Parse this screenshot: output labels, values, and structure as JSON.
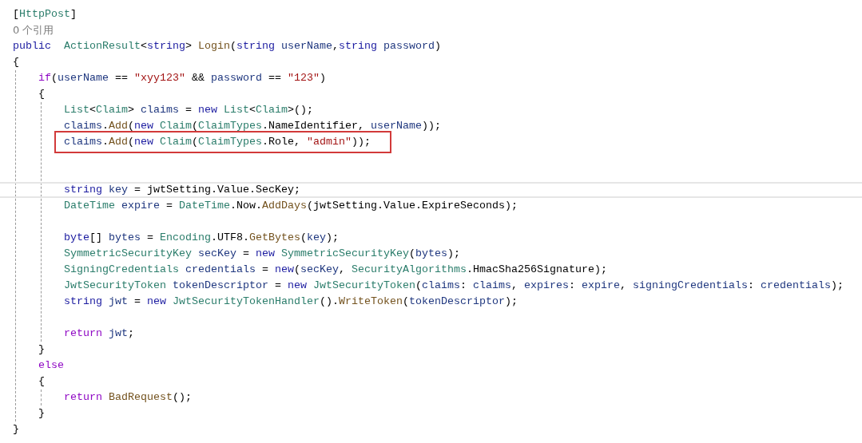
{
  "editor": {
    "lines": [
      {
        "kind": "code",
        "tokens": [
          {
            "text": "[",
            "kind": "plain"
          },
          {
            "text": "HttpPost",
            "kind": "type"
          },
          {
            "text": "]",
            "kind": "plain"
          }
        ]
      },
      {
        "kind": "lens",
        "text": "0 个引用"
      },
      {
        "kind": "code",
        "tokens": [
          {
            "text": "public  ",
            "kind": "kw"
          },
          {
            "text": "ActionResult",
            "kind": "type"
          },
          {
            "text": "<",
            "kind": "plain"
          },
          {
            "text": "string",
            "kind": "kw"
          },
          {
            "text": "> ",
            "kind": "plain"
          },
          {
            "text": "Login",
            "kind": "method"
          },
          {
            "text": "(",
            "kind": "plain"
          },
          {
            "text": "string ",
            "kind": "kw"
          },
          {
            "text": "userName",
            "kind": "var"
          },
          {
            "text": ",",
            "kind": "plain"
          },
          {
            "text": "string ",
            "kind": "kw"
          },
          {
            "text": "password",
            "kind": "var"
          },
          {
            "text": ")",
            "kind": "plain"
          }
        ]
      },
      {
        "kind": "code",
        "tokens": [
          {
            "text": "{",
            "kind": "plain"
          }
        ]
      },
      {
        "kind": "block",
        "children": [
          {
            "kind": "code",
            "tokens": [
              {
                "text": "if",
                "kind": "ctl"
              },
              {
                "text": "(",
                "kind": "plain"
              },
              {
                "text": "userName",
                "kind": "var"
              },
              {
                "text": " == ",
                "kind": "plain"
              },
              {
                "text": "\"xyy123\"",
                "kind": "str"
              },
              {
                "text": " && ",
                "kind": "plain"
              },
              {
                "text": "password",
                "kind": "var"
              },
              {
                "text": " == ",
                "kind": "plain"
              },
              {
                "text": "\"123\"",
                "kind": "str"
              },
              {
                "text": ")",
                "kind": "plain"
              }
            ]
          },
          {
            "kind": "code",
            "tokens": [
              {
                "text": "{",
                "kind": "plain"
              }
            ]
          },
          {
            "kind": "block",
            "children": [
              {
                "kind": "code",
                "tokens": [
                  {
                    "text": "List",
                    "kind": "type"
                  },
                  {
                    "text": "<",
                    "kind": "plain"
                  },
                  {
                    "text": "Claim",
                    "kind": "type"
                  },
                  {
                    "text": "> ",
                    "kind": "plain"
                  },
                  {
                    "text": "claims",
                    "kind": "var"
                  },
                  {
                    "text": " = ",
                    "kind": "plain"
                  },
                  {
                    "text": "new ",
                    "kind": "kw"
                  },
                  {
                    "text": "List",
                    "kind": "type"
                  },
                  {
                    "text": "<",
                    "kind": "plain"
                  },
                  {
                    "text": "Claim",
                    "kind": "type"
                  },
                  {
                    "text": ">();",
                    "kind": "plain"
                  }
                ]
              },
              {
                "kind": "code",
                "tokens": [
                  {
                    "text": "claims",
                    "kind": "var"
                  },
                  {
                    "text": ".",
                    "kind": "plain"
                  },
                  {
                    "text": "Add",
                    "kind": "method"
                  },
                  {
                    "text": "(",
                    "kind": "plain"
                  },
                  {
                    "text": "new ",
                    "kind": "kw"
                  },
                  {
                    "text": "Claim",
                    "kind": "type"
                  },
                  {
                    "text": "(",
                    "kind": "plain"
                  },
                  {
                    "text": "ClaimTypes",
                    "kind": "type"
                  },
                  {
                    "text": ".NameIdentifier, ",
                    "kind": "plain"
                  },
                  {
                    "text": "userName",
                    "kind": "var"
                  },
                  {
                    "text": "));",
                    "kind": "plain"
                  }
                ]
              },
              {
                "kind": "code",
                "highlighted": true,
                "tokens": [
                  {
                    "text": "claims",
                    "kind": "var"
                  },
                  {
                    "text": ".",
                    "kind": "plain"
                  },
                  {
                    "text": "Add",
                    "kind": "method"
                  },
                  {
                    "text": "(",
                    "kind": "plain"
                  },
                  {
                    "text": "new ",
                    "kind": "kw"
                  },
                  {
                    "text": "Claim",
                    "kind": "type"
                  },
                  {
                    "text": "(",
                    "kind": "plain"
                  },
                  {
                    "text": "ClaimTypes",
                    "kind": "type"
                  },
                  {
                    "text": ".Role, ",
                    "kind": "plain"
                  },
                  {
                    "text": "\"admin\"",
                    "kind": "str"
                  },
                  {
                    "text": "));",
                    "kind": "plain"
                  }
                ]
              },
              {
                "kind": "blank"
              },
              {
                "kind": "blank"
              },
              {
                "kind": "code",
                "current": true,
                "tokens": [
                  {
                    "text": "string ",
                    "kind": "kw"
                  },
                  {
                    "text": "key",
                    "kind": "var"
                  },
                  {
                    "text": " = jwtSetting.Value.SecKey;",
                    "kind": "plain"
                  }
                ]
              },
              {
                "kind": "code",
                "tokens": [
                  {
                    "text": "DateTime ",
                    "kind": "type"
                  },
                  {
                    "text": "expire",
                    "kind": "var"
                  },
                  {
                    "text": " = ",
                    "kind": "plain"
                  },
                  {
                    "text": "DateTime",
                    "kind": "type"
                  },
                  {
                    "text": ".Now.",
                    "kind": "plain"
                  },
                  {
                    "text": "AddDays",
                    "kind": "method"
                  },
                  {
                    "text": "(jwtSetting.Value.ExpireSeconds);",
                    "kind": "plain"
                  }
                ]
              },
              {
                "kind": "blank"
              },
              {
                "kind": "code",
                "tokens": [
                  {
                    "text": "byte",
                    "kind": "kw"
                  },
                  {
                    "text": "[] ",
                    "kind": "plain"
                  },
                  {
                    "text": "bytes",
                    "kind": "var"
                  },
                  {
                    "text": " = ",
                    "kind": "plain"
                  },
                  {
                    "text": "Encoding",
                    "kind": "type"
                  },
                  {
                    "text": ".UTF8.",
                    "kind": "plain"
                  },
                  {
                    "text": "GetBytes",
                    "kind": "method"
                  },
                  {
                    "text": "(",
                    "kind": "plain"
                  },
                  {
                    "text": "key",
                    "kind": "var"
                  },
                  {
                    "text": ");",
                    "kind": "plain"
                  }
                ]
              },
              {
                "kind": "code",
                "tokens": [
                  {
                    "text": "SymmetricSecurityKey ",
                    "kind": "type"
                  },
                  {
                    "text": "secKey",
                    "kind": "var"
                  },
                  {
                    "text": " = ",
                    "kind": "plain"
                  },
                  {
                    "text": "new ",
                    "kind": "kw"
                  },
                  {
                    "text": "SymmetricSecurityKey",
                    "kind": "type"
                  },
                  {
                    "text": "(",
                    "kind": "plain"
                  },
                  {
                    "text": "bytes",
                    "kind": "var"
                  },
                  {
                    "text": ");",
                    "kind": "plain"
                  }
                ]
              },
              {
                "kind": "code",
                "tokens": [
                  {
                    "text": "SigningCredentials ",
                    "kind": "type"
                  },
                  {
                    "text": "credentials",
                    "kind": "var"
                  },
                  {
                    "text": " = ",
                    "kind": "plain"
                  },
                  {
                    "text": "new",
                    "kind": "kw"
                  },
                  {
                    "text": "(",
                    "kind": "plain"
                  },
                  {
                    "text": "secKey",
                    "kind": "var"
                  },
                  {
                    "text": ", ",
                    "kind": "plain"
                  },
                  {
                    "text": "SecurityAlgorithms",
                    "kind": "type"
                  },
                  {
                    "text": ".HmacSha256Signature);",
                    "kind": "plain"
                  }
                ]
              },
              {
                "kind": "code",
                "tokens": [
                  {
                    "text": "JwtSecurityToken ",
                    "kind": "type"
                  },
                  {
                    "text": "tokenDescriptor",
                    "kind": "var"
                  },
                  {
                    "text": " = ",
                    "kind": "plain"
                  },
                  {
                    "text": "new ",
                    "kind": "kw"
                  },
                  {
                    "text": "JwtSecurityToken",
                    "kind": "type"
                  },
                  {
                    "text": "(",
                    "kind": "plain"
                  },
                  {
                    "text": "claims",
                    "kind": "var"
                  },
                  {
                    "text": ": ",
                    "kind": "plain"
                  },
                  {
                    "text": "claims",
                    "kind": "var"
                  },
                  {
                    "text": ", ",
                    "kind": "plain"
                  },
                  {
                    "text": "expires",
                    "kind": "var"
                  },
                  {
                    "text": ": ",
                    "kind": "plain"
                  },
                  {
                    "text": "expire",
                    "kind": "var"
                  },
                  {
                    "text": ", ",
                    "kind": "plain"
                  },
                  {
                    "text": "signingCredentials",
                    "kind": "var"
                  },
                  {
                    "text": ": ",
                    "kind": "plain"
                  },
                  {
                    "text": "credentials",
                    "kind": "var"
                  },
                  {
                    "text": ");",
                    "kind": "plain"
                  }
                ]
              },
              {
                "kind": "code",
                "tokens": [
                  {
                    "text": "string ",
                    "kind": "kw"
                  },
                  {
                    "text": "jwt",
                    "kind": "var"
                  },
                  {
                    "text": " = ",
                    "kind": "plain"
                  },
                  {
                    "text": "new ",
                    "kind": "kw"
                  },
                  {
                    "text": "JwtSecurityTokenHandler",
                    "kind": "type"
                  },
                  {
                    "text": "().",
                    "kind": "plain"
                  },
                  {
                    "text": "WriteToken",
                    "kind": "method"
                  },
                  {
                    "text": "(",
                    "kind": "plain"
                  },
                  {
                    "text": "tokenDescriptor",
                    "kind": "var"
                  },
                  {
                    "text": ");",
                    "kind": "plain"
                  }
                ]
              },
              {
                "kind": "blank"
              },
              {
                "kind": "code",
                "tokens": [
                  {
                    "text": "return ",
                    "kind": "ctl"
                  },
                  {
                    "text": "jwt",
                    "kind": "var"
                  },
                  {
                    "text": ";",
                    "kind": "plain"
                  }
                ]
              }
            ]
          },
          {
            "kind": "code",
            "tokens": [
              {
                "text": "}",
                "kind": "plain"
              }
            ]
          },
          {
            "kind": "code",
            "tokens": [
              {
                "text": "else",
                "kind": "ctl"
              }
            ]
          },
          {
            "kind": "code",
            "tokens": [
              {
                "text": "{",
                "kind": "plain"
              }
            ]
          },
          {
            "kind": "block",
            "children": [
              {
                "kind": "code",
                "tokens": [
                  {
                    "text": "return ",
                    "kind": "ctl"
                  },
                  {
                    "text": "BadRequest",
                    "kind": "method"
                  },
                  {
                    "text": "();",
                    "kind": "plain"
                  }
                ]
              }
            ]
          },
          {
            "kind": "code",
            "tokens": [
              {
                "text": "}",
                "kind": "plain"
              }
            ]
          }
        ]
      },
      {
        "kind": "code",
        "tokens": [
          {
            "text": "}",
            "kind": "plain"
          }
        ]
      }
    ]
  }
}
